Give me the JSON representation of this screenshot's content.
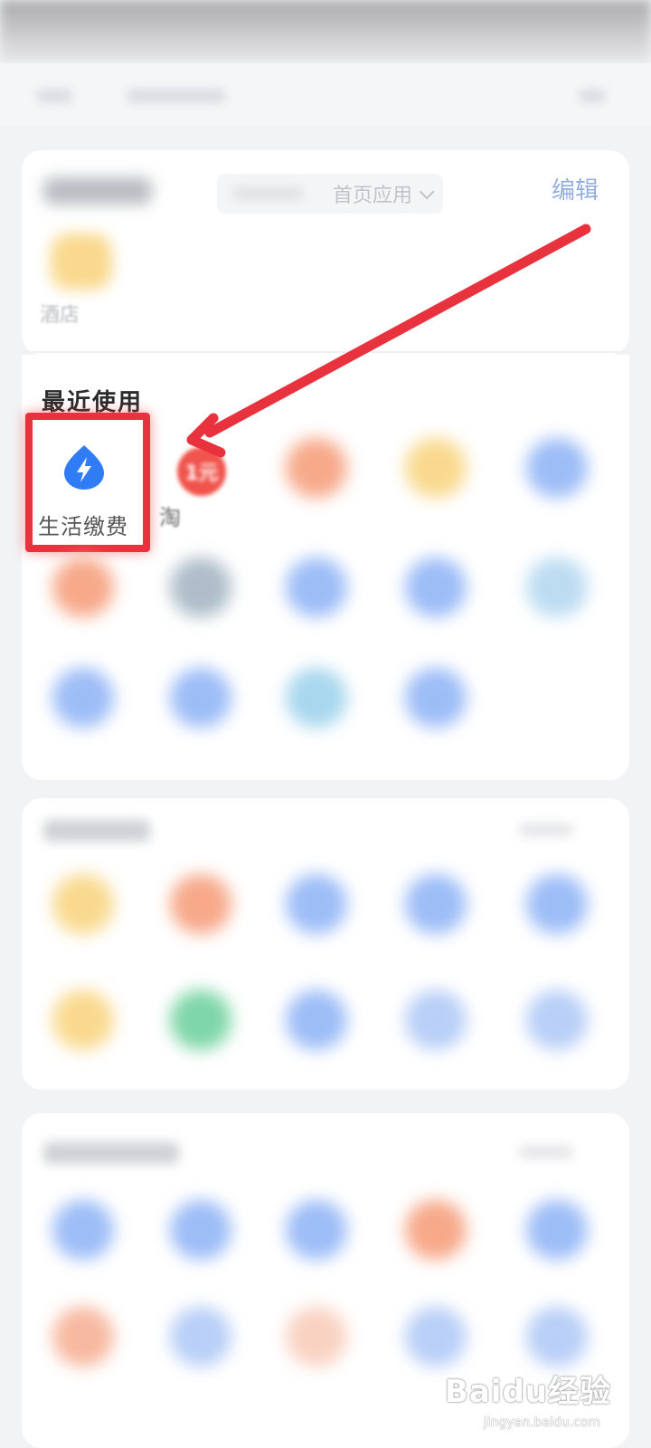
{
  "header": {
    "edit_label": "编辑",
    "homepage_select_label": "首页应用"
  },
  "home_apps": {
    "items": [
      {
        "label": "酒店",
        "icon": "hotel-icon"
      }
    ]
  },
  "recent": {
    "title": "最近使用",
    "items": [
      {
        "label": "生活缴费",
        "icon": "lightning-drop-icon",
        "icon_color": "#2f7cf6"
      },
      {
        "label": "淘",
        "badge": "1元"
      }
    ]
  },
  "annotation": {
    "box_color": "#e8333e",
    "arrow_color": "#e8333e"
  },
  "watermark": {
    "brand": "Baidu经验",
    "url": "jingyan.baidu.com"
  },
  "colors": {
    "page_bg": "#f2f3f5",
    "card_bg": "#ffffff",
    "blue": "#9dbdf7",
    "orange": "#f7a98a",
    "yellow": "#f9d98e",
    "green": "#7fd6a8",
    "teal": "#a8d7ee",
    "gray_blue": "#aebdc9"
  }
}
